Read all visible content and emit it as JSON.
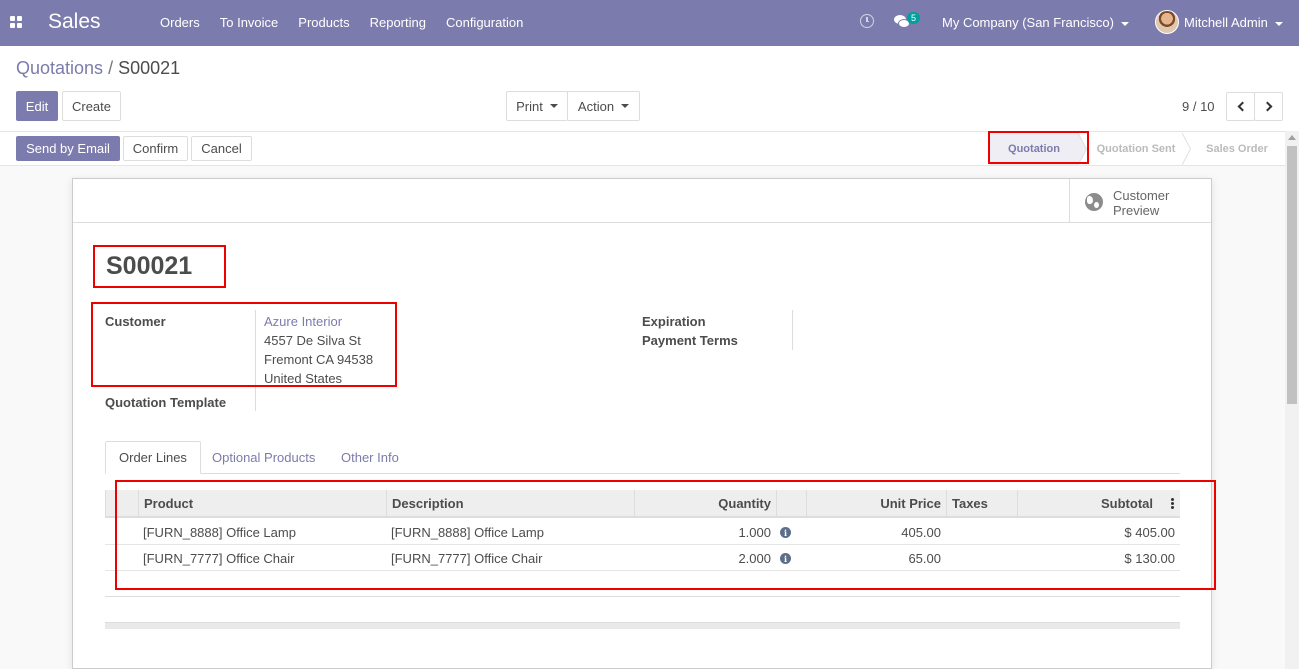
{
  "navbar": {
    "app_name": "Sales",
    "menu": [
      "Orders",
      "To Invoice",
      "Products",
      "Reporting",
      "Configuration"
    ],
    "chat_badge": "5",
    "company": "My Company (San Francisco)",
    "user": "Mitchell Admin",
    "color": "#7c7bad"
  },
  "breadcrumb": {
    "parent": "Quotations",
    "separator": "/",
    "current": "S00021"
  },
  "control": {
    "edit": "Edit",
    "create": "Create",
    "print": "Print",
    "action": "Action",
    "pager": "9 / 10"
  },
  "statusbar": {
    "send_email": "Send by Email",
    "confirm": "Confirm",
    "cancel": "Cancel",
    "stages": [
      "Quotation",
      "Quotation Sent",
      "Sales Order"
    ],
    "active_stage": "Quotation"
  },
  "sheet": {
    "preview_line1": "Customer",
    "preview_line2": "Preview",
    "order_name": "S00021",
    "customer_label": "Customer",
    "customer_name": "Azure Interior",
    "address": [
      "4557 De Silva St",
      "Fremont CA 94538",
      "United States"
    ],
    "template_label": "Quotation Template",
    "expiration_label": "Expiration",
    "payment_terms_label": "Payment Terms"
  },
  "tabs": [
    "Order Lines",
    "Optional Products",
    "Other Info"
  ],
  "order_lines": {
    "columns": [
      "Product",
      "Description",
      "Quantity",
      "Unit Price",
      "Taxes",
      "Subtotal"
    ],
    "rows": [
      {
        "product": "[FURN_8888] Office Lamp",
        "description": "[FURN_8888] Office Lamp",
        "quantity": "1.000",
        "unit_price": "405.00",
        "taxes": "",
        "subtotal": "$ 405.00"
      },
      {
        "product": "[FURN_7777] Office Chair",
        "description": "[FURN_7777] Office Chair",
        "quantity": "2.000",
        "unit_price": "65.00",
        "taxes": "",
        "subtotal": "$ 130.00"
      }
    ]
  },
  "annotation_color": "#e00000"
}
